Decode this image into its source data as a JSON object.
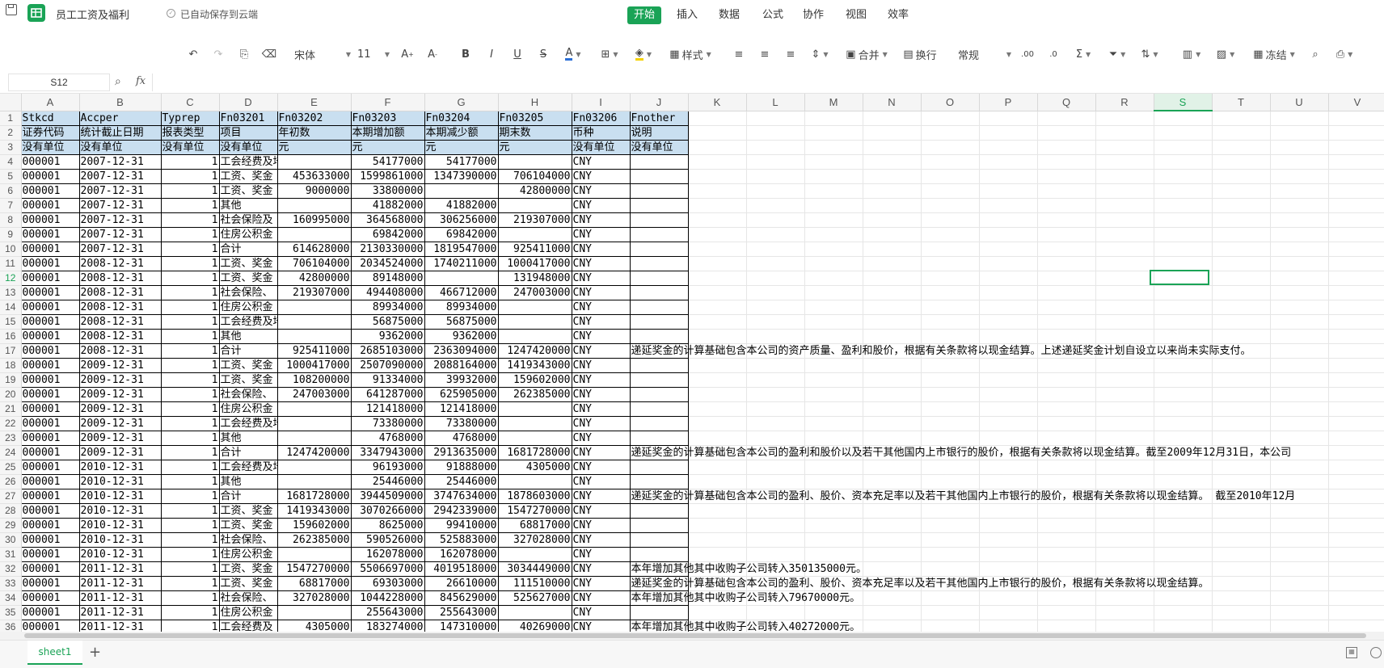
{
  "app": {
    "doc_title": "员工工资及福利",
    "save_status": "已自动保存到云端",
    "menus": [
      "开始",
      "插入",
      "数据",
      "公式",
      "协作",
      "视图",
      "效率"
    ]
  },
  "toolbar": {
    "font_name": "宋体",
    "font_size": "11",
    "style_label": "样式",
    "merge_label": "合并",
    "wrap_label": "换行",
    "number_format": "常规",
    "freeze_label": "冻结"
  },
  "formula_bar": {
    "cell_ref": "S12",
    "fx": "fx",
    "content": ""
  },
  "columns": [
    "A",
    "B",
    "C",
    "D",
    "E",
    "F",
    "G",
    "H",
    "I",
    "J",
    "K",
    "L",
    "M",
    "N",
    "O",
    "P",
    "Q",
    "R",
    "S",
    "T",
    "U",
    "V"
  ],
  "rows": [
    [
      "Stkcd",
      "Accper",
      "Typrep",
      "Fn03201",
      "Fn03202",
      "Fn03203",
      "Fn03204",
      "Fn03205",
      "Fn03206",
      "Fnother"
    ],
    [
      "证券代码",
      "统计截止日期",
      "报表类型",
      "项目",
      "年初数",
      "本期增加额",
      "本期减少额",
      "期末数",
      "币种",
      "说明"
    ],
    [
      "没有单位",
      "没有单位",
      "没有单位",
      "没有单位",
      "元",
      "元",
      "元",
      "元",
      "没有单位",
      "没有单位"
    ],
    [
      "000001",
      "2007-12-31",
      "1",
      "工会经费及培训费",
      "",
      "54177000",
      "54177000",
      "",
      "CNY",
      ""
    ],
    [
      "000001",
      "2007-12-31",
      "1",
      "工资、奖金",
      "453633000",
      "1599861000",
      "1347390000",
      "706104000",
      "CNY",
      ""
    ],
    [
      "000001",
      "2007-12-31",
      "1",
      "工资、奖金",
      "9000000",
      "33800000",
      "",
      "42800000",
      "CNY",
      ""
    ],
    [
      "000001",
      "2007-12-31",
      "1",
      "其他",
      "",
      "41882000",
      "41882000",
      "",
      "CNY",
      ""
    ],
    [
      "000001",
      "2007-12-31",
      "1",
      "社会保险及",
      "160995000",
      "364568000",
      "306256000",
      "219307000",
      "CNY",
      ""
    ],
    [
      "000001",
      "2007-12-31",
      "1",
      "住房公积金",
      "",
      "69842000",
      "69842000",
      "",
      "CNY",
      ""
    ],
    [
      "000001",
      "2007-12-31",
      "1",
      "合计",
      "614628000",
      "2130330000",
      "1819547000",
      "925411000",
      "CNY",
      ""
    ],
    [
      "000001",
      "2008-12-31",
      "1",
      "工资、奖金",
      "706104000",
      "2034524000",
      "1740211000",
      "1000417000",
      "CNY",
      ""
    ],
    [
      "000001",
      "2008-12-31",
      "1",
      "工资、奖金",
      "42800000",
      "89148000",
      "",
      "131948000",
      "CNY",
      ""
    ],
    [
      "000001",
      "2008-12-31",
      "1",
      "社会保险、",
      "219307000",
      "494408000",
      "466712000",
      "247003000",
      "CNY",
      ""
    ],
    [
      "000001",
      "2008-12-31",
      "1",
      "住房公积金",
      "",
      "89934000",
      "89934000",
      "",
      "CNY",
      ""
    ],
    [
      "000001",
      "2008-12-31",
      "1",
      "工会经费及培训费",
      "",
      "56875000",
      "56875000",
      "",
      "CNY",
      ""
    ],
    [
      "000001",
      "2008-12-31",
      "1",
      "其他",
      "",
      "9362000",
      "9362000",
      "",
      "CNY",
      ""
    ],
    [
      "000001",
      "2008-12-31",
      "1",
      "合计",
      "925411000",
      "2685103000",
      "2363094000",
      "1247420000",
      "CNY",
      "递延奖金的计算基础包含本公司的资产质量、盈利和股价，根据有关条款将以现金结算。上述递延奖金计划自设立以来尚未实际支付。"
    ],
    [
      "000001",
      "2009-12-31",
      "1",
      "工资、奖金",
      "1000417000",
      "2507090000",
      "2088164000",
      "1419343000",
      "CNY",
      ""
    ],
    [
      "000001",
      "2009-12-31",
      "1",
      "工资、奖金",
      "108200000",
      "91334000",
      "39932000",
      "159602000",
      "CNY",
      ""
    ],
    [
      "000001",
      "2009-12-31",
      "1",
      "社会保险、",
      "247003000",
      "641287000",
      "625905000",
      "262385000",
      "CNY",
      ""
    ],
    [
      "000001",
      "2009-12-31",
      "1",
      "住房公积金",
      "",
      "121418000",
      "121418000",
      "",
      "CNY",
      ""
    ],
    [
      "000001",
      "2009-12-31",
      "1",
      "工会经费及培训费",
      "",
      "73380000",
      "73380000",
      "",
      "CNY",
      ""
    ],
    [
      "000001",
      "2009-12-31",
      "1",
      "其他",
      "",
      "4768000",
      "4768000",
      "",
      "CNY",
      ""
    ],
    [
      "000001",
      "2009-12-31",
      "1",
      "合计",
      "1247420000",
      "3347943000",
      "2913635000",
      "1681728000",
      "CNY",
      "递延奖金的计算基础包含本公司的盈利和股价以及若干其他国内上市银行的股价，根据有关条款将以现金结算。截至2009年12月31日，本公司"
    ],
    [
      "000001",
      "2010-12-31",
      "1",
      "工会经费及培训费",
      "",
      "96193000",
      "91888000",
      "4305000",
      "CNY",
      ""
    ],
    [
      "000001",
      "2010-12-31",
      "1",
      "其他",
      "",
      "25446000",
      "25446000",
      "",
      "CNY",
      ""
    ],
    [
      "000001",
      "2010-12-31",
      "1",
      "合计",
      "1681728000",
      "3944509000",
      "3747634000",
      "1878603000",
      "CNY",
      "递延奖金的计算基础包含本公司的盈利、股价、资本充足率以及若干其他国内上市银行的股价，根据有关条款将以现金结算。  截至2010年12月"
    ],
    [
      "000001",
      "2010-12-31",
      "1",
      "工资、奖金",
      "1419343000",
      "3070266000",
      "2942339000",
      "1547270000",
      "CNY",
      ""
    ],
    [
      "000001",
      "2010-12-31",
      "1",
      "工资、奖金",
      "159602000",
      "8625000",
      "99410000",
      "68817000",
      "CNY",
      ""
    ],
    [
      "000001",
      "2010-12-31",
      "1",
      "社会保险、",
      "262385000",
      "590526000",
      "525883000",
      "327028000",
      "CNY",
      ""
    ],
    [
      "000001",
      "2010-12-31",
      "1",
      "住房公积金",
      "",
      "162078000",
      "162078000",
      "",
      "CNY",
      ""
    ],
    [
      "000001",
      "2011-12-31",
      "1",
      "工资、奖金",
      "1547270000",
      "5506697000",
      "4019518000",
      "3034449000",
      "CNY",
      "本年增加其他其中收购子公司转入350135000元。"
    ],
    [
      "000001",
      "2011-12-31",
      "1",
      "工资、奖金",
      "68817000",
      "69303000",
      "26610000",
      "111510000",
      "CNY",
      "递延奖金的计算基础包含本公司的盈利、股价、资本充足率以及若干其他国内上市银行的股价，根据有关条款将以现金结算。"
    ],
    [
      "000001",
      "2011-12-31",
      "1",
      "社会保险、",
      "327028000",
      "1044228000",
      "845629000",
      "525627000",
      "CNY",
      "本年增加其他其中收购子公司转入79670000元。"
    ],
    [
      "000001",
      "2011-12-31",
      "1",
      "住房公积金",
      "",
      "255643000",
      "255643000",
      "",
      "CNY",
      ""
    ],
    [
      "000001",
      "2011-12-31",
      "1",
      "工会经费及",
      "4305000",
      "183274000",
      "147310000",
      "40269000",
      "CNY",
      "本年增加其他其中收购子公司转入40272000元。"
    ]
  ],
  "sheet_tabs": [
    "sheet1"
  ],
  "selected_cell": "S12"
}
